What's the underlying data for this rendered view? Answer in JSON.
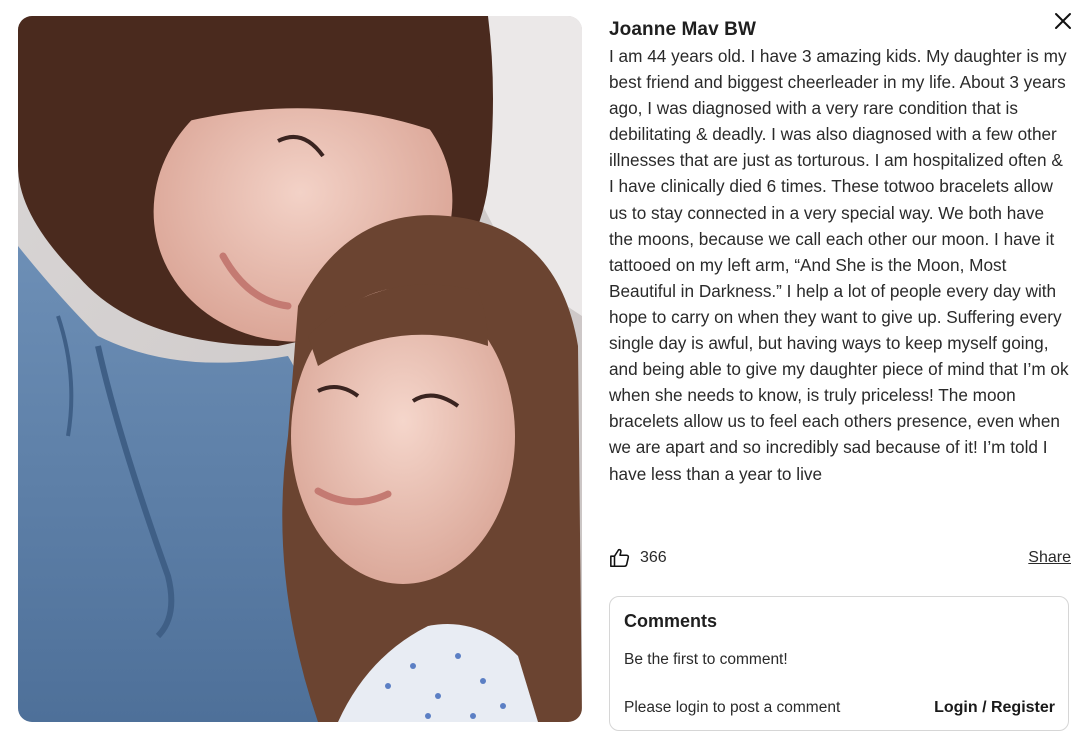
{
  "post": {
    "author": "Joanne Mav BW",
    "body": "I am 44 years old. I have 3 amazing kids. My daughter is my best friend and biggest cheerleader in my life. About 3 years ago, I was diagnosed with a very rare condition that is debilitating & deadly. I was also diagnosed with a few other illnesses that are just as torturous. I am hospitalized often & I have clinically died 6 times. These totwoo bracelets allow us to stay connected in a very special way. We both have the moons, because we call each other our moon. I have it tattooed on my left arm, “And She is the Moon, Most Beautiful in Darkness.” I help a lot of people every day with hope to carry on when they want to give up. Suffering every single day is awful, but having ways to keep myself going, and being able to give my daughter piece of mind that I’m ok when she needs to know, is truly priceless! The moon bracelets allow us to feel each others presence, even when we are apart and so incredibly sad because of it! I’m told I have less than a year to live",
    "like_count": "366",
    "share_label": "Share"
  },
  "comments": {
    "title": "Comments",
    "empty_message": "Be the first to comment!",
    "login_prompt": "Please login to post a comment",
    "login_link": "Login / Register"
  },
  "icons": {
    "close": "close-icon",
    "like": "thumbs-up-icon"
  },
  "colors": {
    "text": "#1f1f1f",
    "border": "#d6d6d6",
    "hoodie": "#5a7ea8",
    "hair": "#4a2a1e"
  }
}
